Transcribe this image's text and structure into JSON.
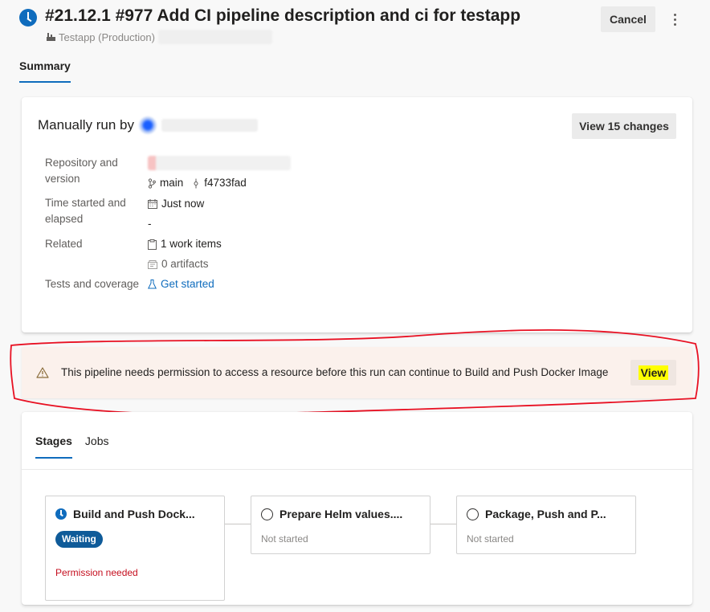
{
  "header": {
    "title": "#21.12.1 #977 Add CI pipeline description and ci for testapp",
    "pipeline": "Testapp (Production)",
    "cancel_label": "Cancel"
  },
  "tabs": {
    "summary": "Summary"
  },
  "summary": {
    "manually_run_by": "Manually run by",
    "view_changes_label": "View 15 changes",
    "repository_label": "Repository and version",
    "branch": "main",
    "commit": "f4733fad",
    "time_label": "Time started and elapsed",
    "time_started": "Just now",
    "elapsed": "-",
    "related_label": "Related",
    "work_items": "1 work items",
    "artifacts": "0 artifacts",
    "tests_label": "Tests and coverage",
    "get_started": "Get started"
  },
  "warning": {
    "message": "This pipeline needs permission to access a resource before this run can continue to Build and Push Docker Image",
    "view_label": "View"
  },
  "stages_panel": {
    "tab_stages": "Stages",
    "tab_jobs": "Jobs",
    "stages": [
      {
        "name": "Build and Push Dock...",
        "status": "Waiting",
        "note": "Permission needed"
      },
      {
        "name": "Prepare Helm values....",
        "status": "Not started"
      },
      {
        "name": "Package, Push and P...",
        "status": "Not started"
      }
    ]
  },
  "colors": {
    "accent": "#0f6cbd",
    "badge": "#0f5b99",
    "warning_bg": "#fbf1ec",
    "error_text": "#c50f1f",
    "highlight": "#ffff00",
    "annotation": "#e81123"
  }
}
